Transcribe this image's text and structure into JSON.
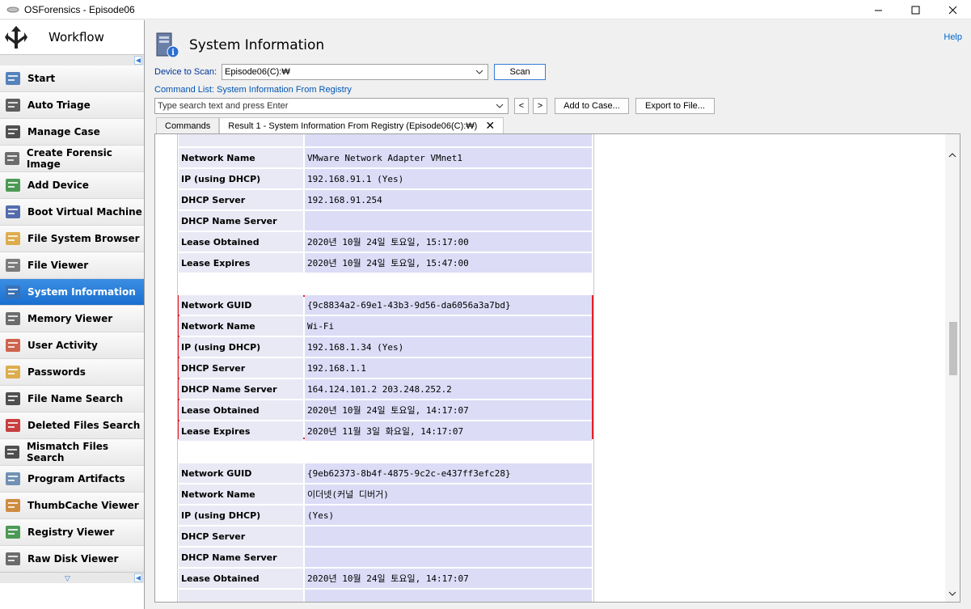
{
  "window": {
    "title": "OSForensics - Episode06"
  },
  "sidebar": {
    "title": "Workflow",
    "items": [
      {
        "label": "Start",
        "icon": "home-arrow-icon",
        "active": false
      },
      {
        "label": "Auto Triage",
        "icon": "fingerprint-icon",
        "active": false
      },
      {
        "label": "Manage Case",
        "icon": "briefcase-icon",
        "active": false
      },
      {
        "label": "Create Forensic Image",
        "icon": "drive-plus-icon",
        "active": false
      },
      {
        "label": "Add Device",
        "icon": "disc-plus-icon",
        "active": false
      },
      {
        "label": "Boot Virtual Machine",
        "icon": "laptop-icon",
        "active": false
      },
      {
        "label": "File System Browser",
        "icon": "folder-search-icon",
        "active": false
      },
      {
        "label": "File Viewer",
        "icon": "file-search-icon",
        "active": false
      },
      {
        "label": "System Information",
        "icon": "computer-info-icon",
        "active": true
      },
      {
        "label": "Memory Viewer",
        "icon": "memory-magnifier-icon",
        "active": false
      },
      {
        "label": "User Activity",
        "icon": "calendar-clock-icon",
        "active": false
      },
      {
        "label": "Passwords",
        "icon": "padlock-icon",
        "active": false
      },
      {
        "label": "File Name Search",
        "icon": "binoculars-icon",
        "active": false
      },
      {
        "label": "Deleted Files Search",
        "icon": "file-delete-icon",
        "active": false
      },
      {
        "label": "Mismatch Files Search",
        "icon": "abc-search-icon",
        "active": false
      },
      {
        "label": "Program Artifacts",
        "icon": "recycle-bin-icon",
        "active": false
      },
      {
        "label": "ThumbCache Viewer",
        "icon": "thumbnail-icon",
        "active": false
      },
      {
        "label": "Registry Viewer",
        "icon": "registry-icon",
        "active": false
      },
      {
        "label": "Raw Disk Viewer",
        "icon": "disk-icon",
        "active": false
      }
    ]
  },
  "main": {
    "title": "System Information",
    "help": "Help",
    "device_label": "Device to Scan:",
    "device_value": "Episode06(C):₩",
    "scan_button": "Scan",
    "command_list_label": "Command List: System Information From Registry",
    "search_placeholder": "Type search text and press Enter",
    "prev_button": "<",
    "next_button": ">",
    "add_to_case_button": "Add to Case...",
    "export_button": "Export to File...",
    "tabs": [
      {
        "label": "Commands"
      },
      {
        "label": "Result 1 - System Information From Registry (Episode06(C):₩)"
      }
    ]
  },
  "report": {
    "rows": [
      {
        "key": "Network Name",
        "value": "VMware Network Adapter VMnet1"
      },
      {
        "key": "IP (using DHCP)",
        "value": "192.168.91.1 (Yes)"
      },
      {
        "key": "DHCP Server",
        "value": "192.168.91.254"
      },
      {
        "key": "DHCP Name Server",
        "value": ""
      },
      {
        "key": "Lease Obtained",
        "value": "2020년 10월 24일 토요일, 15:17:00"
      },
      {
        "key": "Lease Expires",
        "value": "2020년 10월 24일 토요일, 15:47:00"
      },
      {
        "key": "Network GUID",
        "value": "{9c8834a2-69e1-43b3-9d56-da6056a3a7bd}"
      },
      {
        "key": "Network Name",
        "value": "Wi-Fi"
      },
      {
        "key": "IP (using DHCP)",
        "value": "192.168.1.34 (Yes)"
      },
      {
        "key": "DHCP Server",
        "value": "192.168.1.1"
      },
      {
        "key": "DHCP Name Server",
        "value": "164.124.101.2 203.248.252.2"
      },
      {
        "key": "Lease Obtained",
        "value": "2020년 10월 24일 토요일, 14:17:07"
      },
      {
        "key": "Lease Expires",
        "value": "2020년 11월 3일 화요일, 14:17:07"
      },
      {
        "key": "Network GUID",
        "value": "{9eb62373-8b4f-4875-9c2c-e437ff3efc28}"
      },
      {
        "key": "Network Name",
        "value": "이더넷(커널 디버거)"
      },
      {
        "key": "IP (using DHCP)",
        "value": "(Yes)"
      },
      {
        "key": "DHCP Server",
        "value": ""
      },
      {
        "key": "DHCP Name Server",
        "value": ""
      },
      {
        "key": "Lease Obtained",
        "value": "2020년 10월 24일 토요일, 14:17:07"
      }
    ]
  },
  "colors": {
    "accent": "#1a6fd0",
    "highlight": "#e0202a",
    "key_cell": "#e9e9f5",
    "value_cell": "#dcdcf7",
    "link": "#0066cc"
  }
}
